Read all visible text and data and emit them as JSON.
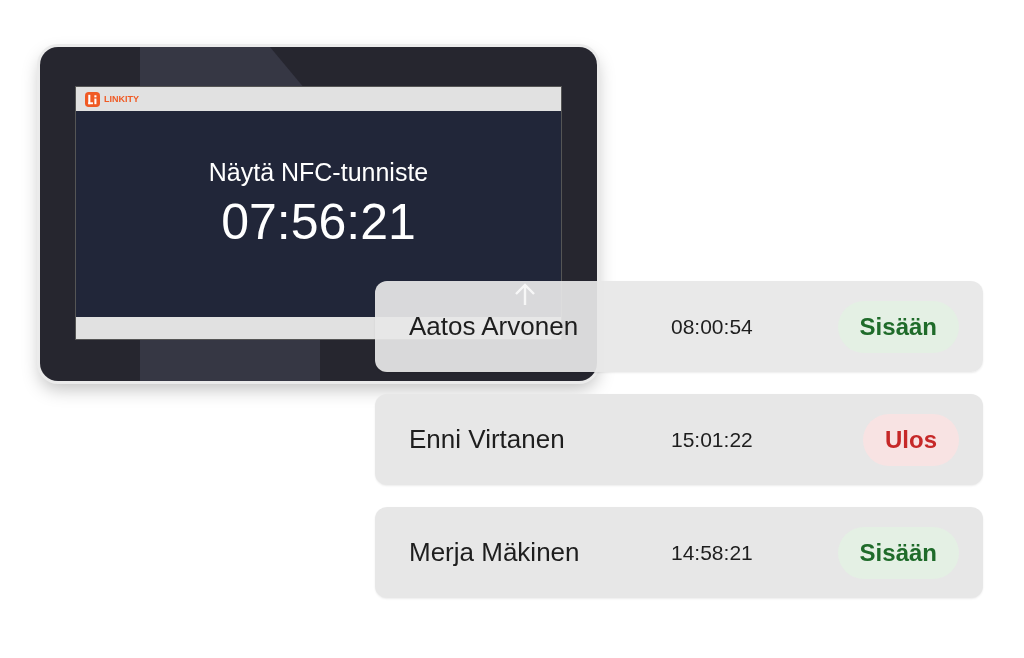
{
  "device": {
    "brand": "LINKITY",
    "prompt": "Näytä NFC-tunniste",
    "clock": "07:56:21"
  },
  "entries": [
    {
      "name": "Aatos Arvonen",
      "time": "08:00:54",
      "status": "Sisään",
      "kind": "in"
    },
    {
      "name": "Enni Virtanen",
      "time": "15:01:22",
      "status": "Ulos",
      "kind": "out"
    },
    {
      "name": "Merja Mäkinen",
      "time": "14:58:21",
      "status": "Sisään",
      "kind": "in"
    }
  ]
}
